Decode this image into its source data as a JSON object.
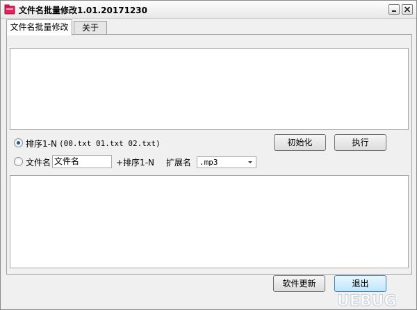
{
  "window": {
    "title": "文件名批量修改1.01.20171230",
    "app_icon": "folder-icon",
    "title_icon_color": "#e0245e",
    "minimize_icon": "minimize-icon",
    "close_icon": "close-icon"
  },
  "tabs": [
    {
      "label": "文件名批量修改",
      "active": true
    },
    {
      "label": "关于",
      "active": false
    }
  ],
  "options": {
    "option1_label": "排序1-N",
    "option1_example": "(00.txt  01.txt 02.txt)",
    "option1_selected": true,
    "option2_label": "文件名",
    "option2_selected": false,
    "filename_value": "文件名",
    "suffix_label": "+排序1-N",
    "extension_label": "扩展名",
    "extension_value": ".mp3"
  },
  "buttons": {
    "init": "初始化",
    "execute": "执行",
    "update": "软件更新",
    "exit": "退出"
  },
  "watermark": {
    "text": "UEBUG"
  }
}
